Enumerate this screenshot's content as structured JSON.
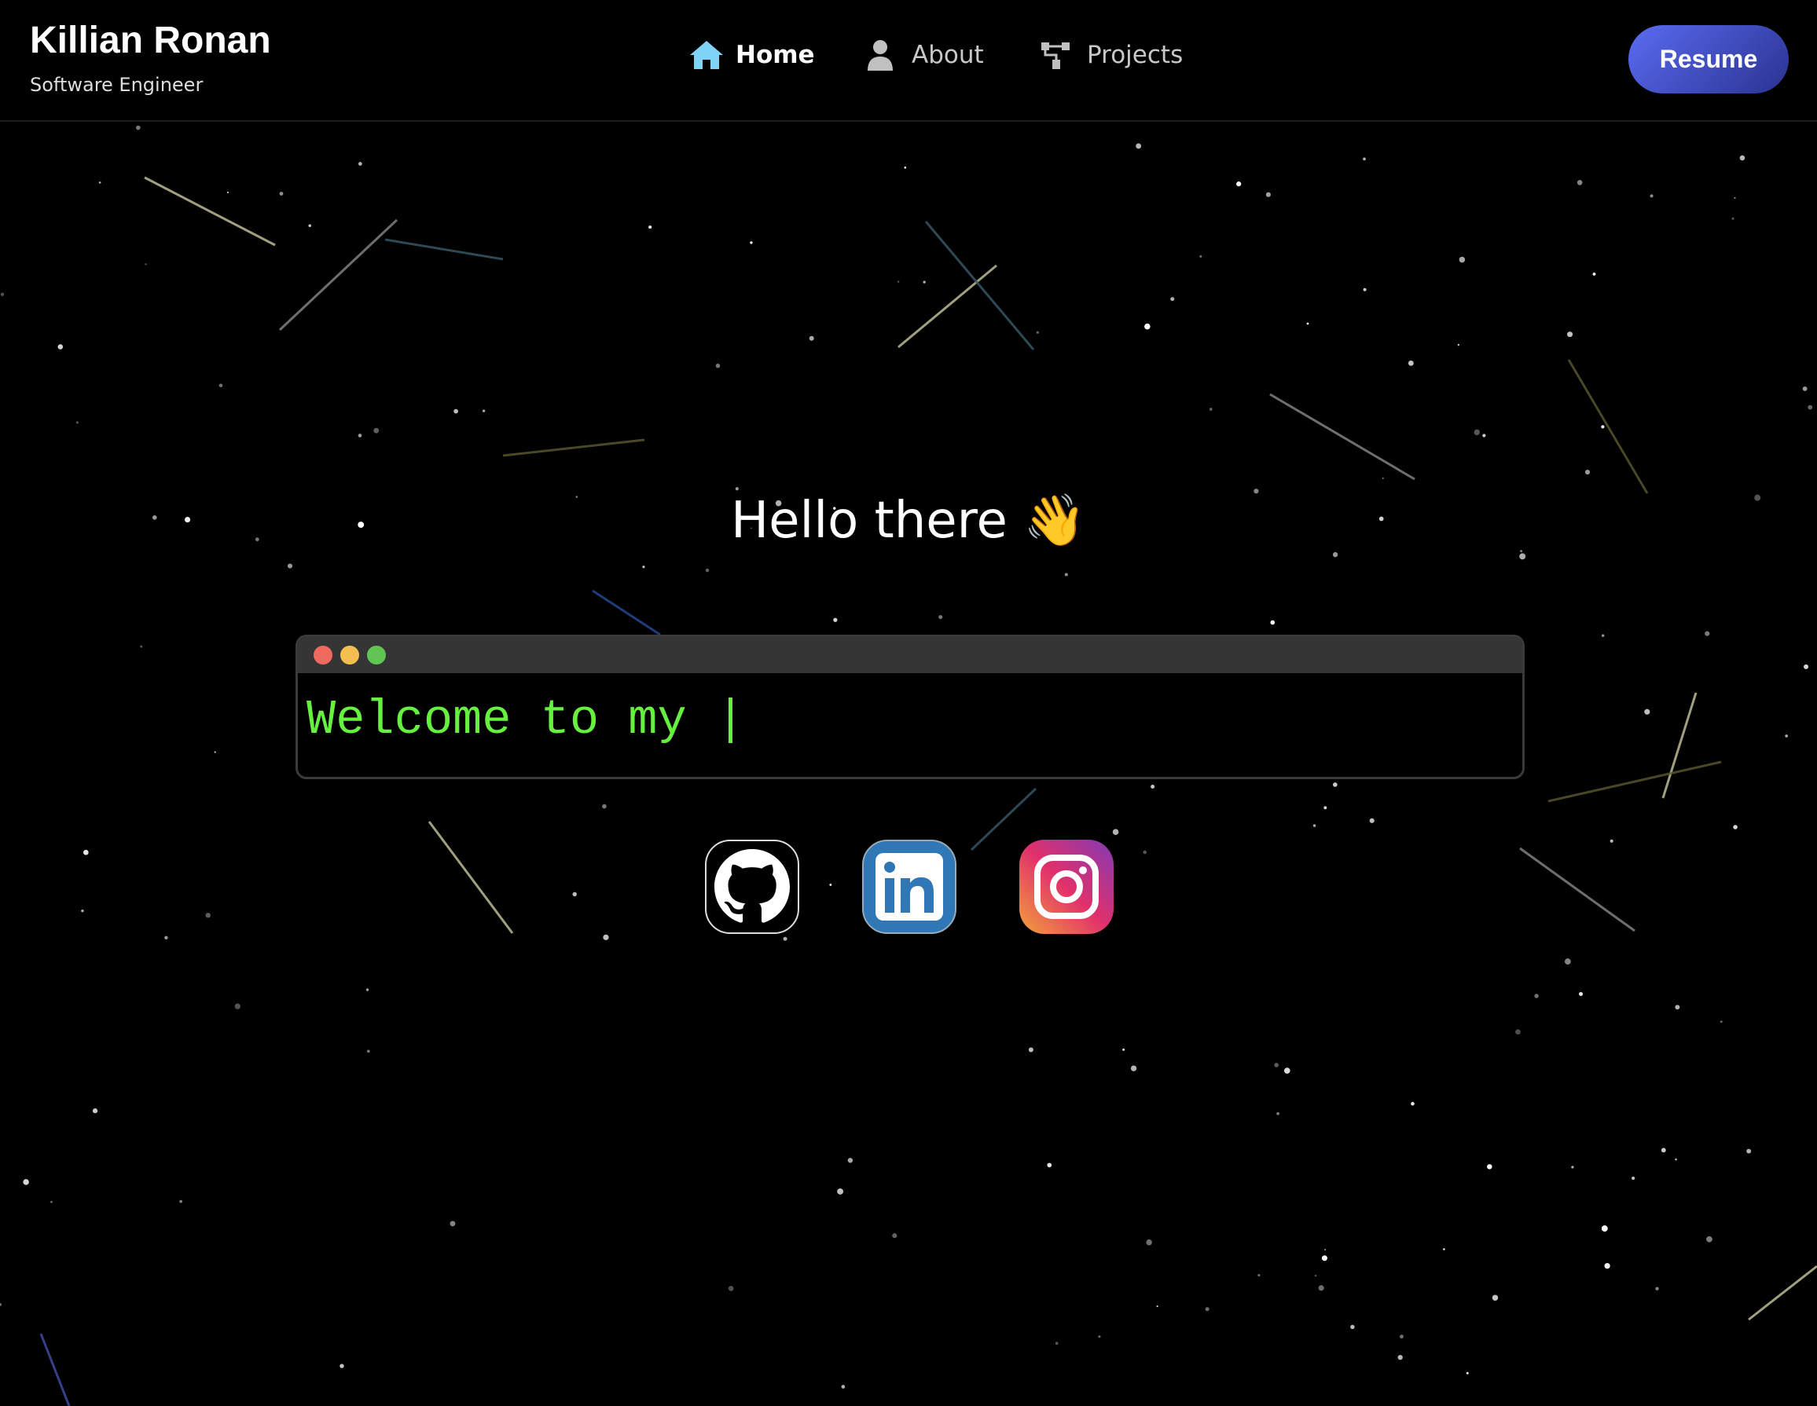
{
  "header": {
    "name": "Killian Ronan",
    "subtitle": "Software Engineer",
    "nav": [
      {
        "label": "Home",
        "icon": "home-icon",
        "active": true
      },
      {
        "label": "About",
        "icon": "user-icon",
        "active": false
      },
      {
        "label": "Projects",
        "icon": "project-tree-icon",
        "active": false
      }
    ],
    "resume_label": "Resume"
  },
  "hero": {
    "greeting": "Hello there",
    "emoji": "👋",
    "terminal_text": "Welcome to my |"
  },
  "socials": [
    {
      "name": "GitHub",
      "icon": "github-icon"
    },
    {
      "name": "LinkedIn",
      "icon": "linkedin-icon"
    },
    {
      "name": "Instagram",
      "icon": "instagram-icon"
    }
  ],
  "colors": {
    "background": "#000000",
    "terminal_text": "#66f03f",
    "home_icon": "#7fd3f7",
    "resume_start": "#5a6cf2",
    "resume_end": "#2a3290",
    "dot_red": "#ee6a5e",
    "dot_yellow": "#f5bf4f",
    "dot_green": "#61c554"
  }
}
